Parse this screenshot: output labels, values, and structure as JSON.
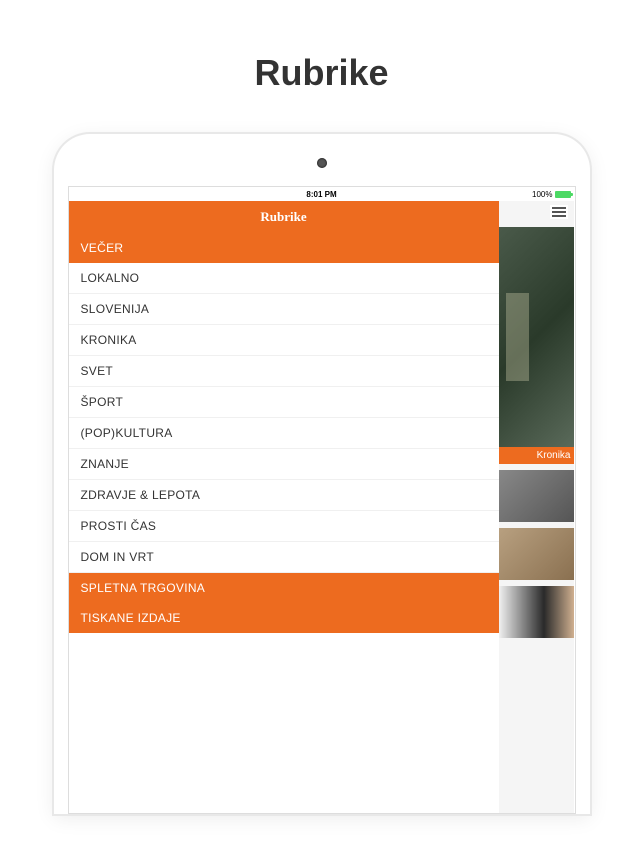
{
  "page": {
    "title": "Rubrike"
  },
  "status": {
    "time": "8:01 PM",
    "battery": "100%"
  },
  "sidebar": {
    "header": "Rubrike",
    "section_top": "VEČER",
    "items": [
      "LOKALNO",
      "SLOVENIJA",
      "KRONIKA",
      "SVET",
      "ŠPORT",
      "(POP)KULTURA",
      "ZNANJE",
      "ZDRAVJE & LEPOTA",
      "PROSTI ČAS",
      "DOM IN VRT"
    ],
    "section_bottom_1": "SPLETNA TRGOVINA",
    "section_bottom_2": "TISKANE IZDAJE"
  },
  "main": {
    "article_tag": "Kronika"
  },
  "colors": {
    "accent": "#ed6b1f"
  }
}
